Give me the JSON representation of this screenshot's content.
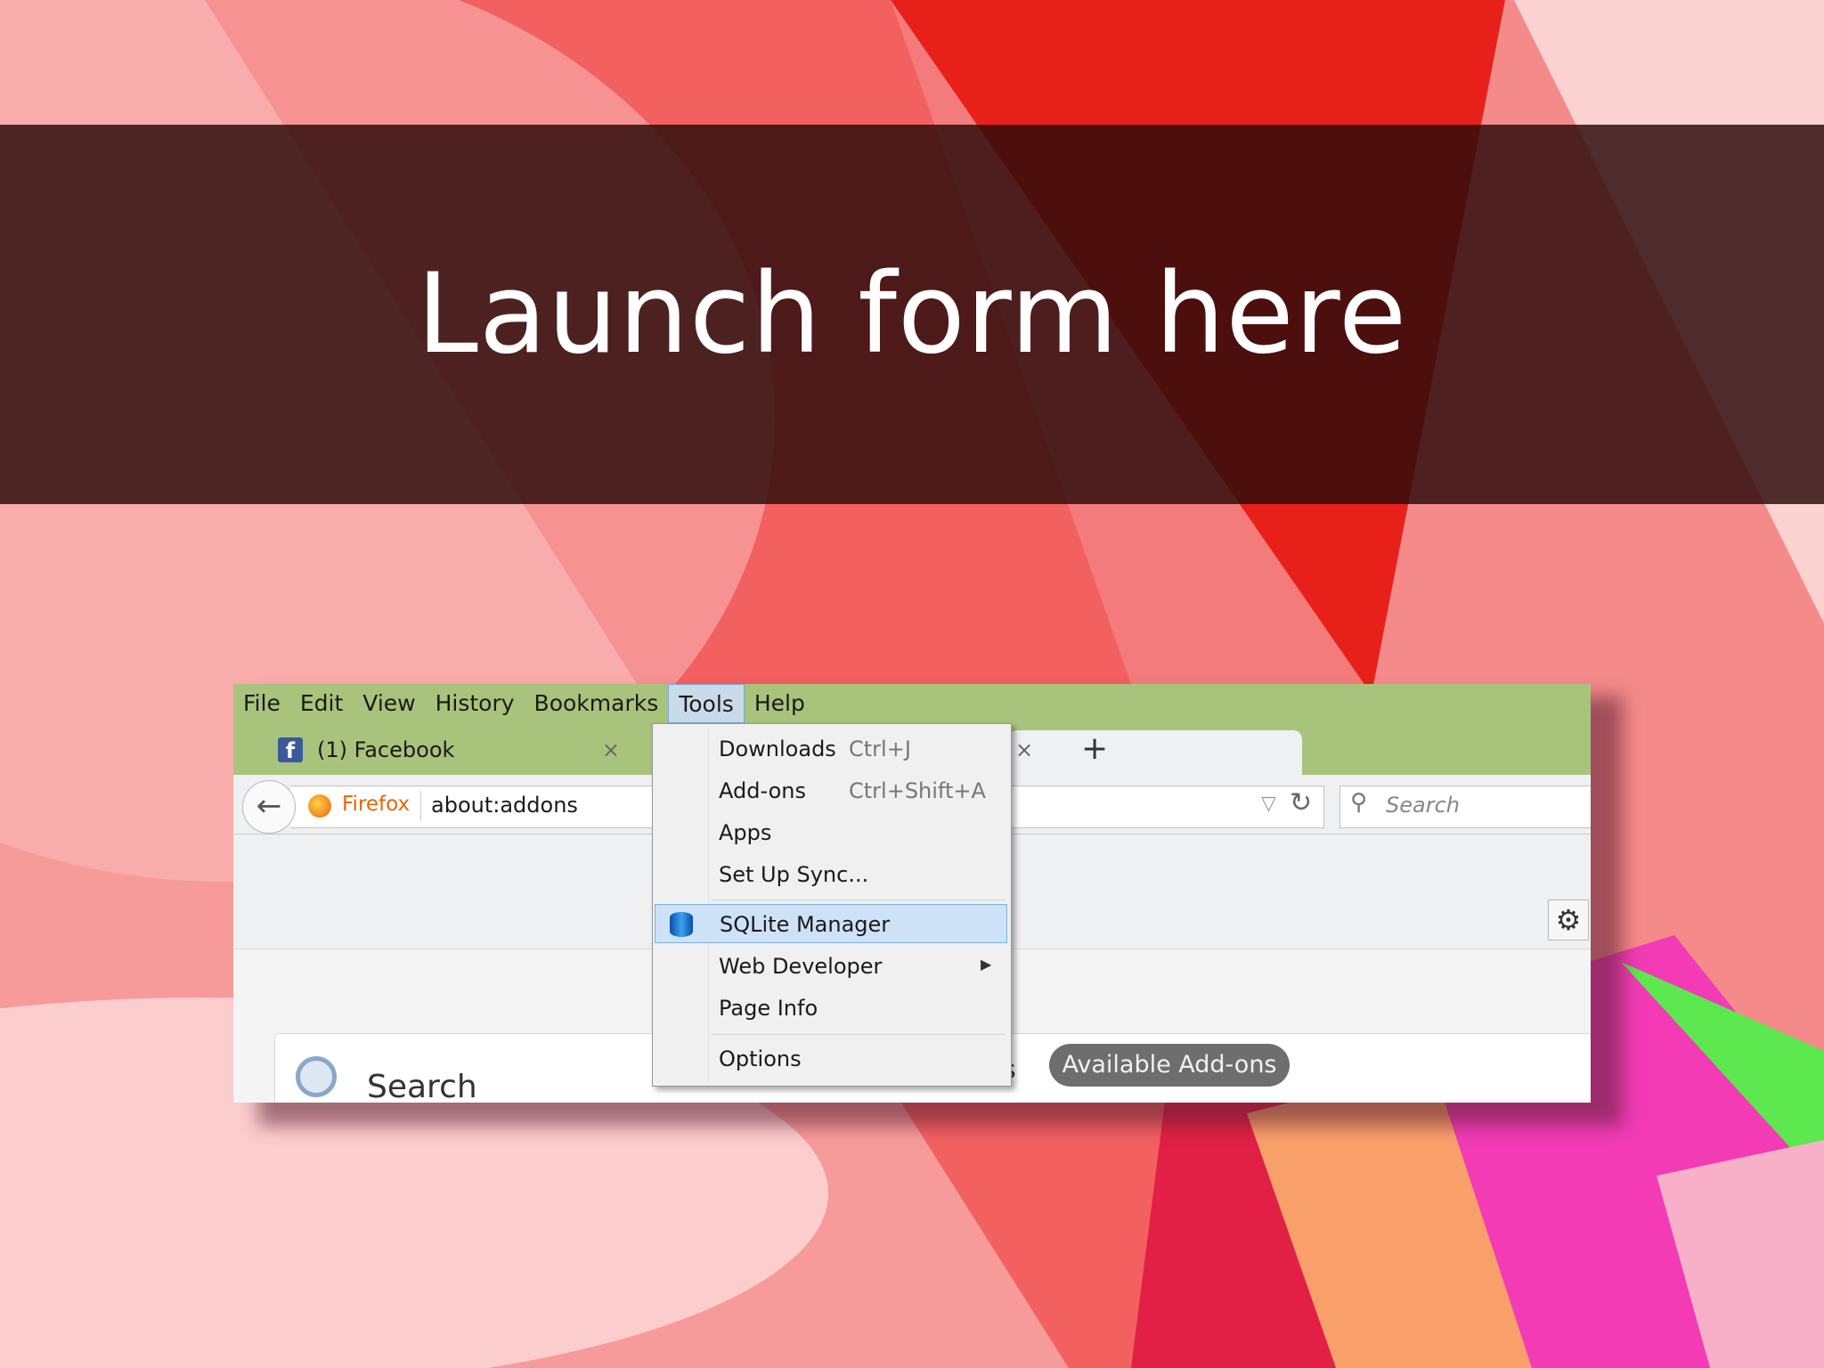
{
  "slide": {
    "title": "Launch form here"
  },
  "browser": {
    "menubar": [
      "File",
      "Edit",
      "View",
      "History",
      "Bookmarks",
      "Tools",
      "Help"
    ],
    "active_menu": "Tools",
    "tabs": {
      "first_tab_label": "(1) Facebook",
      "favicon_letter": "f",
      "close_glyph": "×",
      "new_tab_glyph": "+"
    },
    "navbar": {
      "identity_label": "Firefox",
      "url": "about:addons",
      "search_placeholder": "Search"
    },
    "content": {
      "search_label": "Search",
      "partial_text": "s",
      "available_addons_label": "Available Add-ons"
    },
    "tools_menu": {
      "items": [
        {
          "label": "Downloads",
          "shortcut": "Ctrl+J"
        },
        {
          "label": "Add-ons",
          "shortcut": "Ctrl+Shift+A"
        },
        {
          "label": "Apps",
          "shortcut": ""
        },
        {
          "label": "Set Up Sync...",
          "shortcut": ""
        },
        {
          "label": "SQLite Manager",
          "shortcut": "",
          "highlighted": true
        },
        {
          "label": "Web Developer",
          "shortcut": "",
          "submenu": true
        },
        {
          "label": "Page Info",
          "shortcut": ""
        },
        {
          "label": "Options",
          "shortcut": ""
        }
      ]
    }
  },
  "colors": {
    "title_band": "#2d0c0c",
    "menubar_green": "#a8c47c",
    "highlight_blue": "#cde2f6",
    "firefox_orange": "#e8630a",
    "facebook_blue": "#3b5998"
  }
}
